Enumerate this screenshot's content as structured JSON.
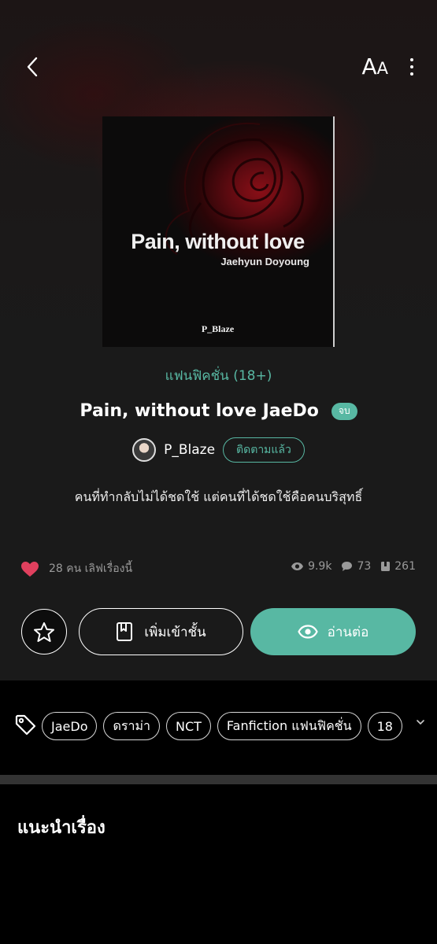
{
  "header": {
    "back_icon": "chevron-left-icon",
    "font_size_large": "A",
    "font_size_small": "A",
    "more_icon": "more-vertical-icon"
  },
  "cover": {
    "title": "Pain, without love",
    "subtitle": "Jaehyun Doyoung",
    "author": "P_Blaze"
  },
  "book": {
    "category": "แฟนฟิคชั่น (18+)",
    "title": "Pain, without love JaeDo",
    "status_badge": "จบ",
    "author_name": "P_Blaze",
    "follow_label": "ติดตามแล้ว",
    "synopsis": "คนที่ทำกลับไม่ได้ชดใช้ แต่คนที่ได้ชดใช้คือคนบริสุทธิ์"
  },
  "stats": {
    "likes_text": "28 คน เลิฟเรื่องนี้",
    "views": "9.9k",
    "comments": "73",
    "chapters": "261"
  },
  "actions": {
    "add_library_label": "เพิ่มเข้าชั้น",
    "continue_reading_label": "อ่านต่อ"
  },
  "tags": [
    "JaeDo",
    "ดราม่า",
    "NCT",
    "Fanfiction แฟนฟิคชั่น",
    "18"
  ],
  "recommend": {
    "title": "แนะนำเรื่อง"
  },
  "colors": {
    "accent": "#58b8a3",
    "heart": "#e0405e",
    "background": "#1a1a1a"
  }
}
